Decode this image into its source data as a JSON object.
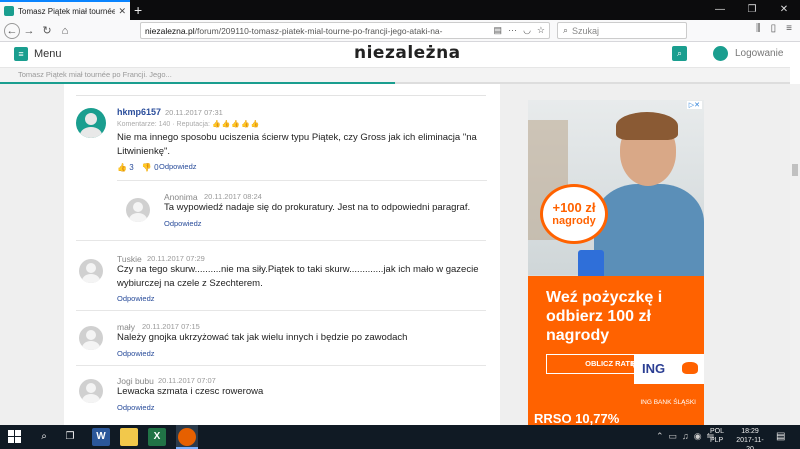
{
  "browser": {
    "tab_title": "Tomasz Piątek miał tournée po",
    "url_host": "niezalezna.pl",
    "url_path": "/forum/209110-tomasz-piatek-mial-tourne-po-francji-jego-ataki-na-",
    "search_placeholder": "Szukaj",
    "win_minimize": "—",
    "win_maximize": "❐",
    "win_close": "✕"
  },
  "site": {
    "menu_label": "Menu",
    "logo": "niezależna",
    "login_label": "Logowanie",
    "breadcrumb": "Tomasz Piątek miał tournée po Francji. Jego..."
  },
  "comments": [
    {
      "author": "hkmp6157",
      "date": "20.11.2017 07:31",
      "meta": "Komentarze: 140 · Reputacja:",
      "text": "Nie ma innego sposobu uciszenia ścierw typu Piątek, czy Gross jak ich eliminacja \"na Litwinienkę\".",
      "upvotes": "3",
      "downvotes": "0",
      "reply": "Odpowiedz"
    },
    {
      "author": "Anonima",
      "date": "20.11.2017 08:24",
      "text": "Ta wypowiedź nadaje się do prokuratury. Jest na to odpowiedni paragraf.",
      "reply": "Odpowiedz"
    },
    {
      "author": "Tuskie",
      "date": "20.11.2017 07:29",
      "text": "Czy na tego skurw..........nie ma siły.Piątek to taki skurw.............jak ich mało w gazecie wybiurczej na czele z Szechterem.",
      "reply": "Odpowiedz"
    },
    {
      "author": "mały",
      "date": "20.11.2017 07:15",
      "text": "Należy gnojka ukrzyżować tak jak wielu innych i będzie po zawodach",
      "reply": "Odpowiedz"
    },
    {
      "author": "Jogi bubu",
      "date": "20.11.2017 07:07",
      "text": "Lewacka szmata i czesc rowerowa",
      "reply": "Odpowiedz"
    }
  ],
  "ad": {
    "bubble_value": "+100 zł",
    "bubble_label": "nagrody",
    "headline": "Weź pożyczkę i odbierz 100 zł nagrody",
    "cta": "OBLICZ RATĘ",
    "brand": "ING",
    "bank_name": "ING BANK ŚLĄSKI",
    "bottom_text": "RRSO 10,77%"
  },
  "taskbar": {
    "lang_line1": "POL",
    "lang_line2": "PLP",
    "time": "18:29",
    "date": "2017-11-20"
  },
  "colors": {
    "accent": "#1a9e8f",
    "link": "#2a4d9b",
    "ad_orange": "#ff6200"
  }
}
